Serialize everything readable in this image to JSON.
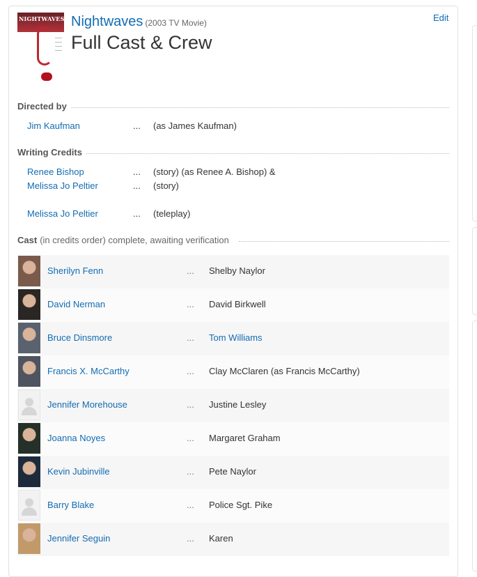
{
  "movie": {
    "title": "Nightwaves",
    "year_type": "(2003 TV Movie)",
    "poster_text": "NIGHTWAVES"
  },
  "page": {
    "title": "Full Cast & Crew",
    "edit_label": "Edit"
  },
  "directed_by": {
    "heading": "Directed by",
    "credits": [
      {
        "name": "Jim Kaufman",
        "ellipsis": "...",
        "role": "(as James Kaufman)"
      }
    ]
  },
  "writing_credits": {
    "heading": "Writing Credits",
    "credits": [
      {
        "name": "Renee Bishop",
        "ellipsis": "...",
        "role": "(story) (as Renee A. Bishop) &"
      },
      {
        "name": "Melissa Jo Peltier",
        "ellipsis": "...",
        "role": "(story)"
      },
      {
        "name": "Melissa Jo Peltier",
        "ellipsis": "...",
        "role": "(teleplay)"
      }
    ]
  },
  "cast": {
    "heading": "Cast",
    "subheading": "(in credits order) complete, awaiting verification",
    "rows": [
      {
        "actor": "Sherilyn Fenn",
        "ellipsis": "...",
        "character": "Shelby Naylor",
        "character_link": false,
        "photo": "photo",
        "tone": "#7a5a4a"
      },
      {
        "actor": "David Nerman",
        "ellipsis": "...",
        "character": "David Birkwell",
        "character_link": false,
        "photo": "photo",
        "tone": "#2a2624"
      },
      {
        "actor": "Bruce Dinsmore",
        "ellipsis": "...",
        "character": "Tom Williams",
        "character_link": true,
        "photo": "photo",
        "tone": "#59626e"
      },
      {
        "actor": "Francis X. McCarthy",
        "ellipsis": "...",
        "character": "Clay McClaren (as Francis McCarthy)",
        "character_link": false,
        "photo": "photo",
        "tone": "#4e5460"
      },
      {
        "actor": "Jennifer Morehouse",
        "ellipsis": "...",
        "character": "Justine Lesley",
        "character_link": false,
        "photo": "default",
        "tone": "#e0e0e0"
      },
      {
        "actor": "Joanna Noyes",
        "ellipsis": "...",
        "character": "Margaret Graham",
        "character_link": false,
        "photo": "photo",
        "tone": "#243028"
      },
      {
        "actor": "Kevin Jubinville",
        "ellipsis": "...",
        "character": "Pete Naylor",
        "character_link": false,
        "photo": "photo",
        "tone": "#1d2a3c"
      },
      {
        "actor": "Barry Blake",
        "ellipsis": "...",
        "character": "Police Sgt. Pike",
        "character_link": false,
        "photo": "default",
        "tone": "#e0e0e0"
      },
      {
        "actor": "Jennifer Seguin",
        "ellipsis": "...",
        "character": "Karen",
        "character_link": false,
        "photo": "photo",
        "tone": "#c29a6a"
      }
    ]
  },
  "colors": {
    "link": "#136cb2",
    "text": "#333333",
    "row_odd": "#f6f6f6",
    "row_even": "#fbfbfb"
  }
}
